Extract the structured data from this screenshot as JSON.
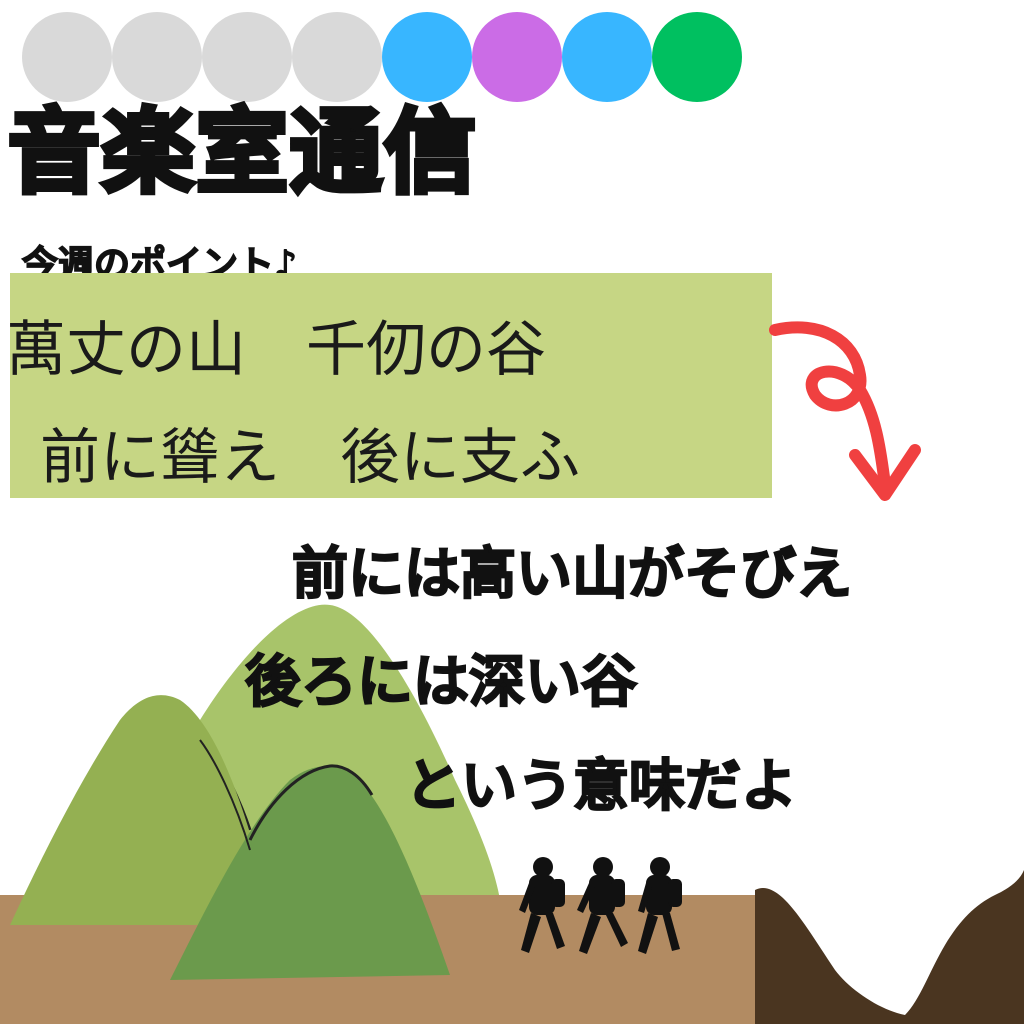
{
  "progress_dots": [
    {
      "name": "dot-1",
      "color": "#d9d9d9"
    },
    {
      "name": "dot-2",
      "color": "#d9d9d9"
    },
    {
      "name": "dot-3",
      "color": "#d9d9d9"
    },
    {
      "name": "dot-4",
      "color": "#d9d9d9"
    },
    {
      "name": "dot-5",
      "color": "#38b6ff"
    },
    {
      "name": "dot-6",
      "color": "#cb6ce6"
    },
    {
      "name": "dot-7",
      "color": "#38b6ff"
    },
    {
      "name": "dot-8",
      "color": "#00c060"
    }
  ],
  "header": {
    "title": "音楽室通信",
    "subtitle": "今週のポイント♪"
  },
  "phrase": {
    "line1": "萬丈の山　千仞の谷",
    "line2": "前に聳え　後に支ふ",
    "box_color": "#c6d684"
  },
  "meaning": {
    "line1": "前には高い山がそびえ",
    "line2": "後ろには深い谷",
    "line3": "という意味だよ"
  },
  "colors": {
    "arrow": "#f04040",
    "mountain_back": "#a8c46a",
    "mountain_left": "#94b052",
    "mountain_front": "#6b9a4c",
    "ground": "#b28b62",
    "cliff": "#4a3520",
    "hiker": "#111111"
  }
}
